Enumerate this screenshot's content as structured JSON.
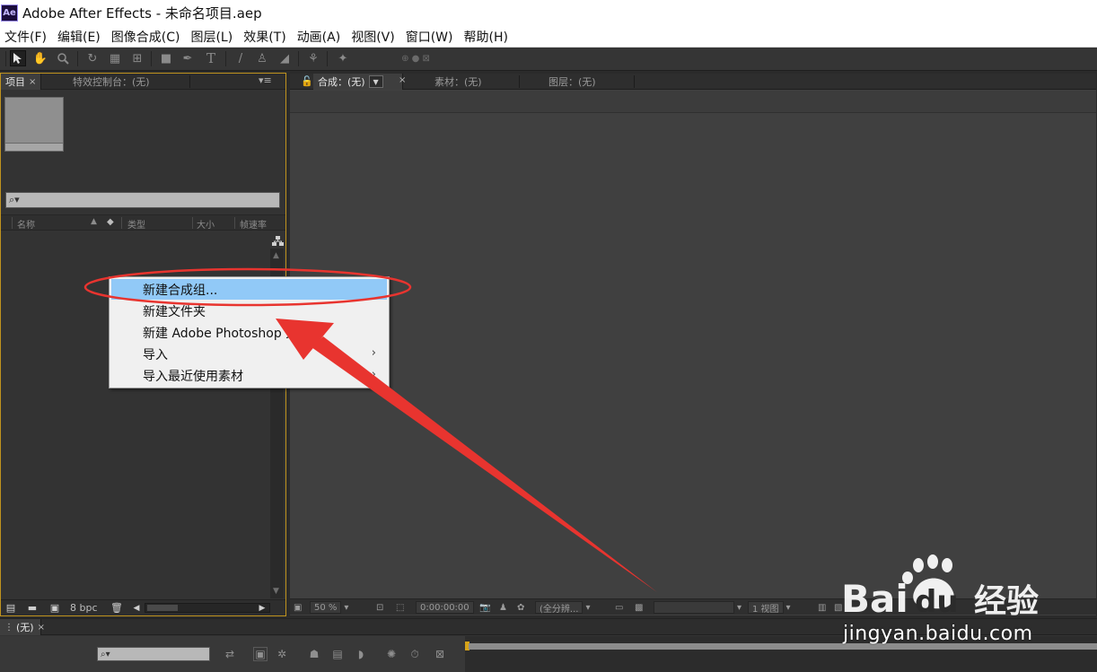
{
  "window": {
    "logo_text": "Ae",
    "title": "Adobe After Effects - 未命名项目.aep"
  },
  "menu": [
    "文件(F)",
    "编辑(E)",
    "图像合成(C)",
    "图层(L)",
    "效果(T)",
    "动画(A)",
    "视图(V)",
    "窗口(W)",
    "帮助(H)"
  ],
  "toolbar": {
    "tools": [
      "selection-tool",
      "hand-tool",
      "zoom-tool",
      "rotate-tool",
      "camera-tool",
      "pan-behind-tool",
      "rectangle-tool",
      "pen-tool",
      "type-tool",
      "brush-tool",
      "clone-stamp-tool",
      "eraser-tool",
      "roto-brush-tool",
      "puppet-pin-tool"
    ],
    "active_tool": "selection-tool"
  },
  "project_panel": {
    "tab_project": "项目",
    "tab_effects": "特效控制台：(无)",
    "search_placeholder": "",
    "columns": [
      "名称",
      "类型",
      "大小",
      "帧速率"
    ],
    "footer_bpc": "8 bpc"
  },
  "comp_panel": {
    "tab_comp": "合成：(无)",
    "tab_footage": "素材：(无)",
    "tab_layer": "图层：(无)",
    "footer": {
      "zoom": "50 %",
      "timecode": "0:00:00:00",
      "resolution": "(全分辨...",
      "views": "1 视图"
    }
  },
  "timeline": {
    "tab": "(无)"
  },
  "context_menu": {
    "items": [
      {
        "label": "新建合成组...",
        "submenu": false,
        "highlighted": true
      },
      {
        "label": "新建文件夹",
        "submenu": false,
        "highlighted": false
      },
      {
        "label": "新建 Adobe Photoshop 文件...",
        "submenu": false,
        "highlighted": false
      },
      {
        "label": "导入",
        "submenu": true,
        "highlighted": false
      },
      {
        "label": "导入最近使用素材",
        "submenu": true,
        "highlighted": false
      }
    ]
  },
  "watermark": {
    "brand_latin_1": "Bai",
    "brand_latin_2": "du",
    "brand_cn": "经验",
    "url": "jingyan.baidu.com"
  },
  "colors": {
    "panel_border_active": "#c0931e",
    "menu_highlight": "#91c9f7",
    "annotation_red": "#e8342f"
  }
}
